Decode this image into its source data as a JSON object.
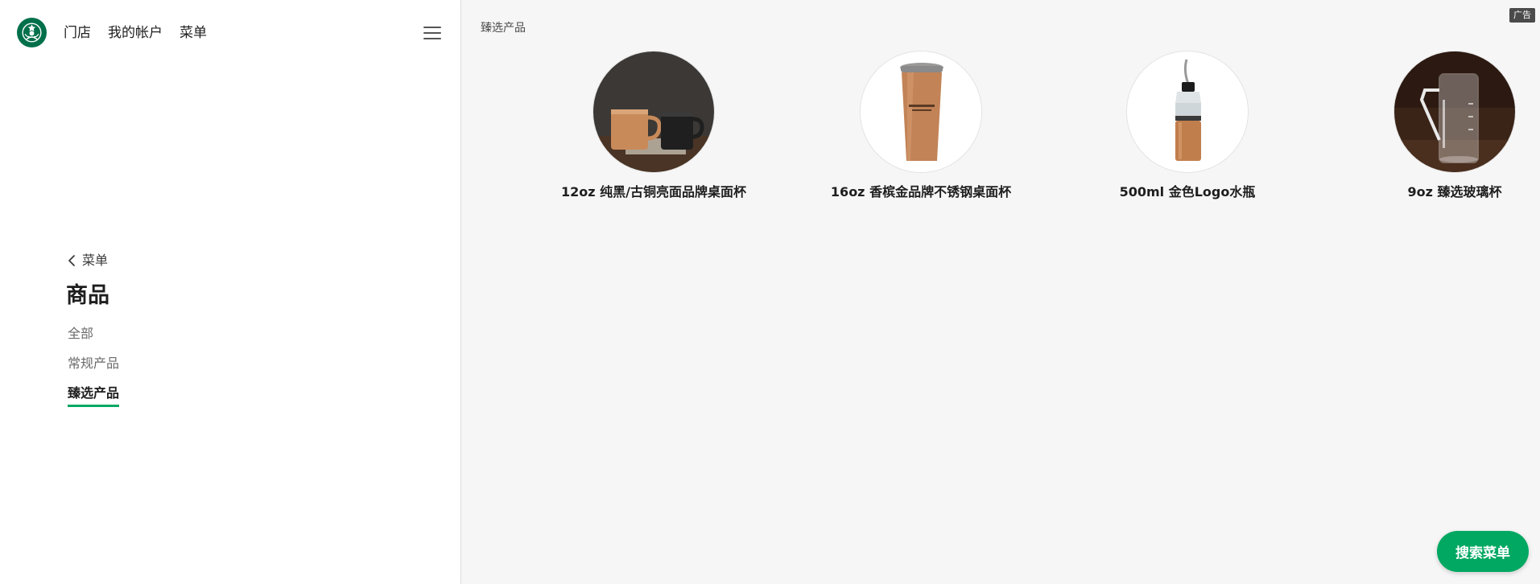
{
  "brand": {
    "logo_icon": "starbucks-siren-logo-icon",
    "color": "#00704a"
  },
  "header": {
    "nav": [
      {
        "label": "门店"
      },
      {
        "label": "我的帐户"
      },
      {
        "label": "菜单"
      }
    ],
    "menu_icon": "hamburger-icon"
  },
  "sidebar": {
    "back_label": "菜单",
    "back_icon": "chevron-left-icon",
    "title": "商品",
    "categories": [
      {
        "label": "全部"
      },
      {
        "label": "常规产品"
      },
      {
        "label": "臻选产品",
        "active": true
      }
    ],
    "active_underline_color": "#00a862"
  },
  "main": {
    "ad_label": "广告",
    "breadcrumb": "臻选产品",
    "products": [
      {
        "name": "12oz 纯黑/古铜亮面品牌桌面杯",
        "image_icon": "copper-and-black-mugs-photo"
      },
      {
        "name": "16oz 香槟金品牌不锈钢桌面杯",
        "image_icon": "copper-tumbler-photo"
      },
      {
        "name": "500ml 金色Logo水瓶",
        "image_icon": "gold-water-bottle-photo"
      },
      {
        "name": "9oz 臻选玻璃杯",
        "image_icon": "glass-mug-photo"
      }
    ],
    "search_button_label": "搜索菜单",
    "accent_color": "#00a862"
  }
}
